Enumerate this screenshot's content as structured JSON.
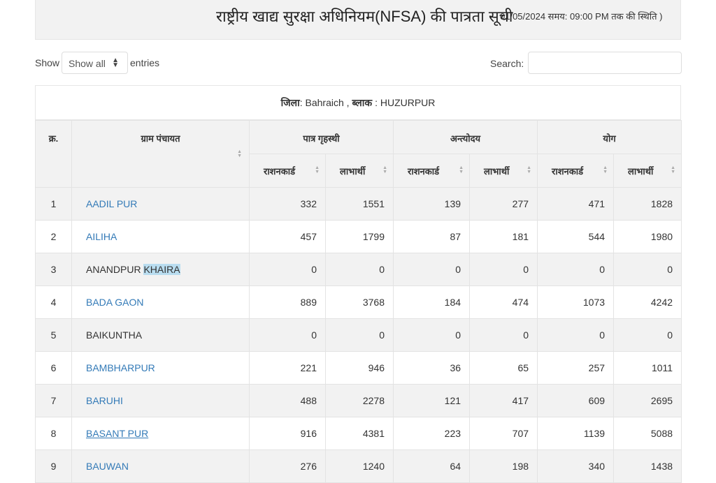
{
  "header": {
    "title": "राष्ट्रीय खाद्य सुरक्षा अधिनियम(NFSA) की पात्रता सूची",
    "status": "01/05/2024 समय: 09:00 PM तक की स्थिति )"
  },
  "controls": {
    "show_label": "Show",
    "show_value": "Show all",
    "entries_label": "entries",
    "search_label": "Search:",
    "search_value": ""
  },
  "caption": {
    "district_label": "जिला",
    "district_value": ": Bahraich , ",
    "block_label": "ब्लाक",
    "block_value": ": HUZURPUR"
  },
  "table": {
    "headers": {
      "sn": "क्र.",
      "gram_panchayat": "ग्राम पंचायत",
      "group1": "पात्र गृहस्थी",
      "group2": "अन्त्योदय",
      "group3": "योग",
      "ration_card": "राशनकार्ड",
      "beneficiary": "लाभार्थी"
    },
    "rows": [
      {
        "sn": "1",
        "name": "AADIL PUR",
        "link": true,
        "v": [
          "332",
          "1551",
          "139",
          "277",
          "471",
          "1828"
        ]
      },
      {
        "sn": "2",
        "name": "AILIHA",
        "link": true,
        "v": [
          "457",
          "1799",
          "87",
          "181",
          "544",
          "1980"
        ]
      },
      {
        "sn": "3",
        "name": "ANANDPUR KHAIRA",
        "name_a": "ANANDPUR ",
        "name_b": "KHAIRA",
        "link": false,
        "v": [
          "0",
          "0",
          "0",
          "0",
          "0",
          "0"
        ]
      },
      {
        "sn": "4",
        "name": "BADA GAON",
        "link": true,
        "v": [
          "889",
          "3768",
          "184",
          "474",
          "1073",
          "4242"
        ]
      },
      {
        "sn": "5",
        "name": "BAIKUNTHA",
        "link": false,
        "v": [
          "0",
          "0",
          "0",
          "0",
          "0",
          "0"
        ]
      },
      {
        "sn": "6",
        "name": "BAMBHARPUR",
        "link": true,
        "v": [
          "221",
          "946",
          "36",
          "65",
          "257",
          "1011"
        ]
      },
      {
        "sn": "7",
        "name": "BARUHI",
        "link": true,
        "v": [
          "488",
          "2278",
          "121",
          "417",
          "609",
          "2695"
        ]
      },
      {
        "sn": "8",
        "name": "BASANT PUR",
        "link": true,
        "underline": true,
        "v": [
          "916",
          "4381",
          "223",
          "707",
          "1139",
          "5088"
        ]
      },
      {
        "sn": "9",
        "name": "BAUWAN",
        "link": true,
        "v": [
          "276",
          "1240",
          "64",
          "198",
          "340",
          "1438"
        ]
      }
    ]
  },
  "colors": {
    "link": "#337ab7",
    "header_bg": "#f2f2f2",
    "stripe": "#f2f2f2",
    "selection": "#b9ddf0"
  }
}
